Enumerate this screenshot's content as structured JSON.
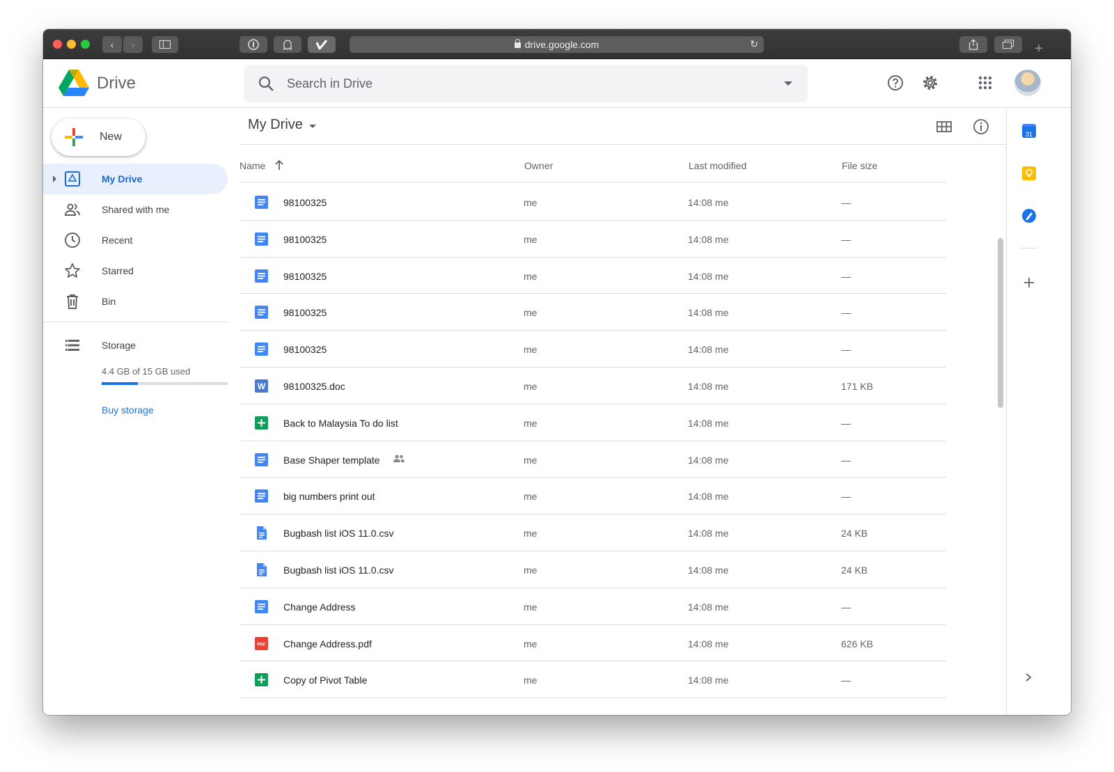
{
  "browser": {
    "url": "drive.google.com",
    "traffic_lights": [
      "#fe5f57",
      "#febc2e",
      "#28c840"
    ]
  },
  "app": {
    "brand": "Drive",
    "search_placeholder": "Search in Drive",
    "header_icons": [
      "help-icon",
      "settings-icon",
      "apps-grid-icon"
    ]
  },
  "sidebar": {
    "new_label": "New",
    "items": [
      {
        "label": "My Drive",
        "icon": "my-drive-icon",
        "active": true
      },
      {
        "label": "Shared with me",
        "icon": "shared-people-icon"
      },
      {
        "label": "Recent",
        "icon": "clock-icon"
      },
      {
        "label": "Starred",
        "icon": "star-icon"
      },
      {
        "label": "Bin",
        "icon": "trash-icon"
      }
    ],
    "storage": {
      "label": "Storage",
      "used_text": "4.4 GB of 15 GB used",
      "used_fraction": 0.29,
      "buy_label": "Buy storage"
    }
  },
  "main": {
    "title": "My Drive",
    "columns": {
      "name": "Name",
      "owner": "Owner",
      "modified": "Last modified",
      "size": "File size"
    },
    "files": [
      {
        "name": "98100325",
        "type": "doc",
        "owner": "me",
        "modified": "14:08 me",
        "size": "—"
      },
      {
        "name": "98100325",
        "type": "doc",
        "owner": "me",
        "modified": "14:08 me",
        "size": "—"
      },
      {
        "name": "98100325",
        "type": "doc",
        "owner": "me",
        "modified": "14:08 me",
        "size": "—"
      },
      {
        "name": "98100325",
        "type": "doc",
        "owner": "me",
        "modified": "14:08 me",
        "size": "—"
      },
      {
        "name": "98100325",
        "type": "doc",
        "owner": "me",
        "modified": "14:08 me",
        "size": "—"
      },
      {
        "name": "98100325.doc",
        "type": "word",
        "owner": "me",
        "modified": "14:08 me",
        "size": "171 KB"
      },
      {
        "name": "Back to Malaysia To do list",
        "type": "sheet",
        "owner": "me",
        "modified": "14:08 me",
        "size": "—"
      },
      {
        "name": "Base Shaper template",
        "type": "doc",
        "owner": "me",
        "modified": "14:08 me",
        "size": "—",
        "shared": true
      },
      {
        "name": "big numbers print out",
        "type": "doc",
        "owner": "me",
        "modified": "14:08 me",
        "size": "—"
      },
      {
        "name": "Bugbash list iOS 11.0.csv",
        "type": "file",
        "owner": "me",
        "modified": "14:08 me",
        "size": "24 KB"
      },
      {
        "name": "Bugbash list iOS 11.0.csv",
        "type": "file",
        "owner": "me",
        "modified": "14:08 me",
        "size": "24 KB"
      },
      {
        "name": "Change Address",
        "type": "doc",
        "owner": "me",
        "modified": "14:08 me",
        "size": "—"
      },
      {
        "name": "Change Address.pdf",
        "type": "pdf",
        "owner": "me",
        "modified": "14:08 me",
        "size": "626 KB"
      },
      {
        "name": "Copy of Pivot Table",
        "type": "sheet",
        "owner": "me",
        "modified": "14:08 me",
        "size": "—"
      }
    ]
  },
  "side_panel": {
    "calendar_label": "31",
    "icons": [
      "calendar-icon",
      "keep-icon",
      "tasks-icon",
      "add-addon-icon",
      "expand-panel-icon"
    ]
  }
}
